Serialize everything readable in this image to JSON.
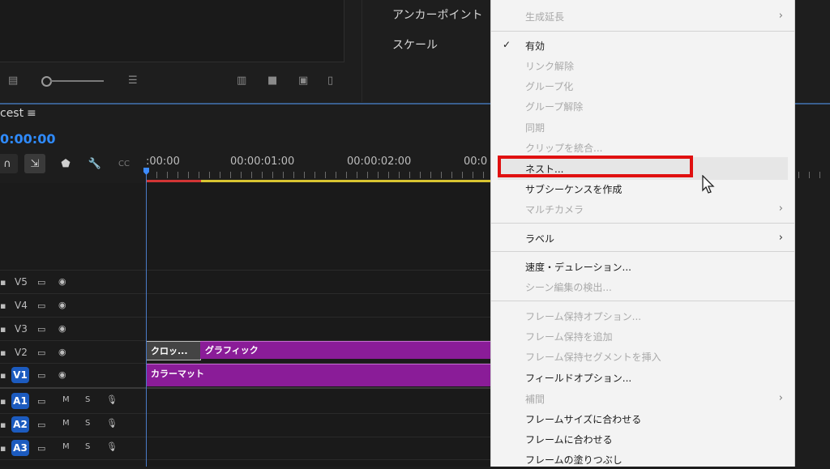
{
  "effect_controls": {
    "anchor_point_label": "アンカーポイント",
    "scale_label": "スケール"
  },
  "sequence": {
    "title": "cest",
    "menu_icon": "≡",
    "timecode": "0:00:00"
  },
  "ruler": {
    "labels": [
      ":00:00",
      "00:00:01:00",
      "00:00:02:00",
      "00:0"
    ]
  },
  "tracks": {
    "video": [
      "V5",
      "V4",
      "V3",
      "V2",
      "V1"
    ],
    "audio": [
      "A1",
      "A2",
      "A3"
    ],
    "mute_label": "M",
    "solo_label": "S"
  },
  "clips": {
    "kurosu": "クロッ...",
    "graphic": "グラフィック",
    "color_matte": "カラーマット"
  },
  "context_menu": {
    "items": [
      {
        "label": "生成延長",
        "enabled": false,
        "submenu": true
      },
      {
        "label": "有効",
        "enabled": true,
        "checked": true
      },
      {
        "label": "リンク解除",
        "enabled": false
      },
      {
        "label": "グループ化",
        "enabled": false
      },
      {
        "label": "グループ解除",
        "enabled": false
      },
      {
        "label": "同期",
        "enabled": false
      },
      {
        "label": "クリップを統合...",
        "enabled": false
      },
      {
        "label": "ネスト...",
        "enabled": true,
        "highlighted": true
      },
      {
        "label": "サブシーケンスを作成",
        "enabled": true
      },
      {
        "label": "マルチカメラ",
        "enabled": false,
        "submenu": true
      },
      {
        "label": "ラベル",
        "enabled": true,
        "submenu": true
      },
      {
        "label": "速度・デュレーション...",
        "enabled": true
      },
      {
        "label": "シーン編集の検出...",
        "enabled": false
      },
      {
        "label": "フレーム保持オプション...",
        "enabled": false
      },
      {
        "label": "フレーム保持を追加",
        "enabled": false
      },
      {
        "label": "フレーム保持セグメントを挿入",
        "enabled": false
      },
      {
        "label": "フィールドオプション...",
        "enabled": true
      },
      {
        "label": "補間",
        "enabled": false,
        "submenu": true
      },
      {
        "label": "フレームサイズに合わせる",
        "enabled": true
      },
      {
        "label": "フレームに合わせる",
        "enabled": true
      },
      {
        "label": "フレームの塗りつぶし",
        "enabled": true
      }
    ]
  },
  "colors": {
    "accent_blue": "#2f8bff",
    "clip_purple": "#8a1c98",
    "highlight_red": "#e01010",
    "render_red": "#d23535",
    "render_yellow": "#d8c431"
  }
}
